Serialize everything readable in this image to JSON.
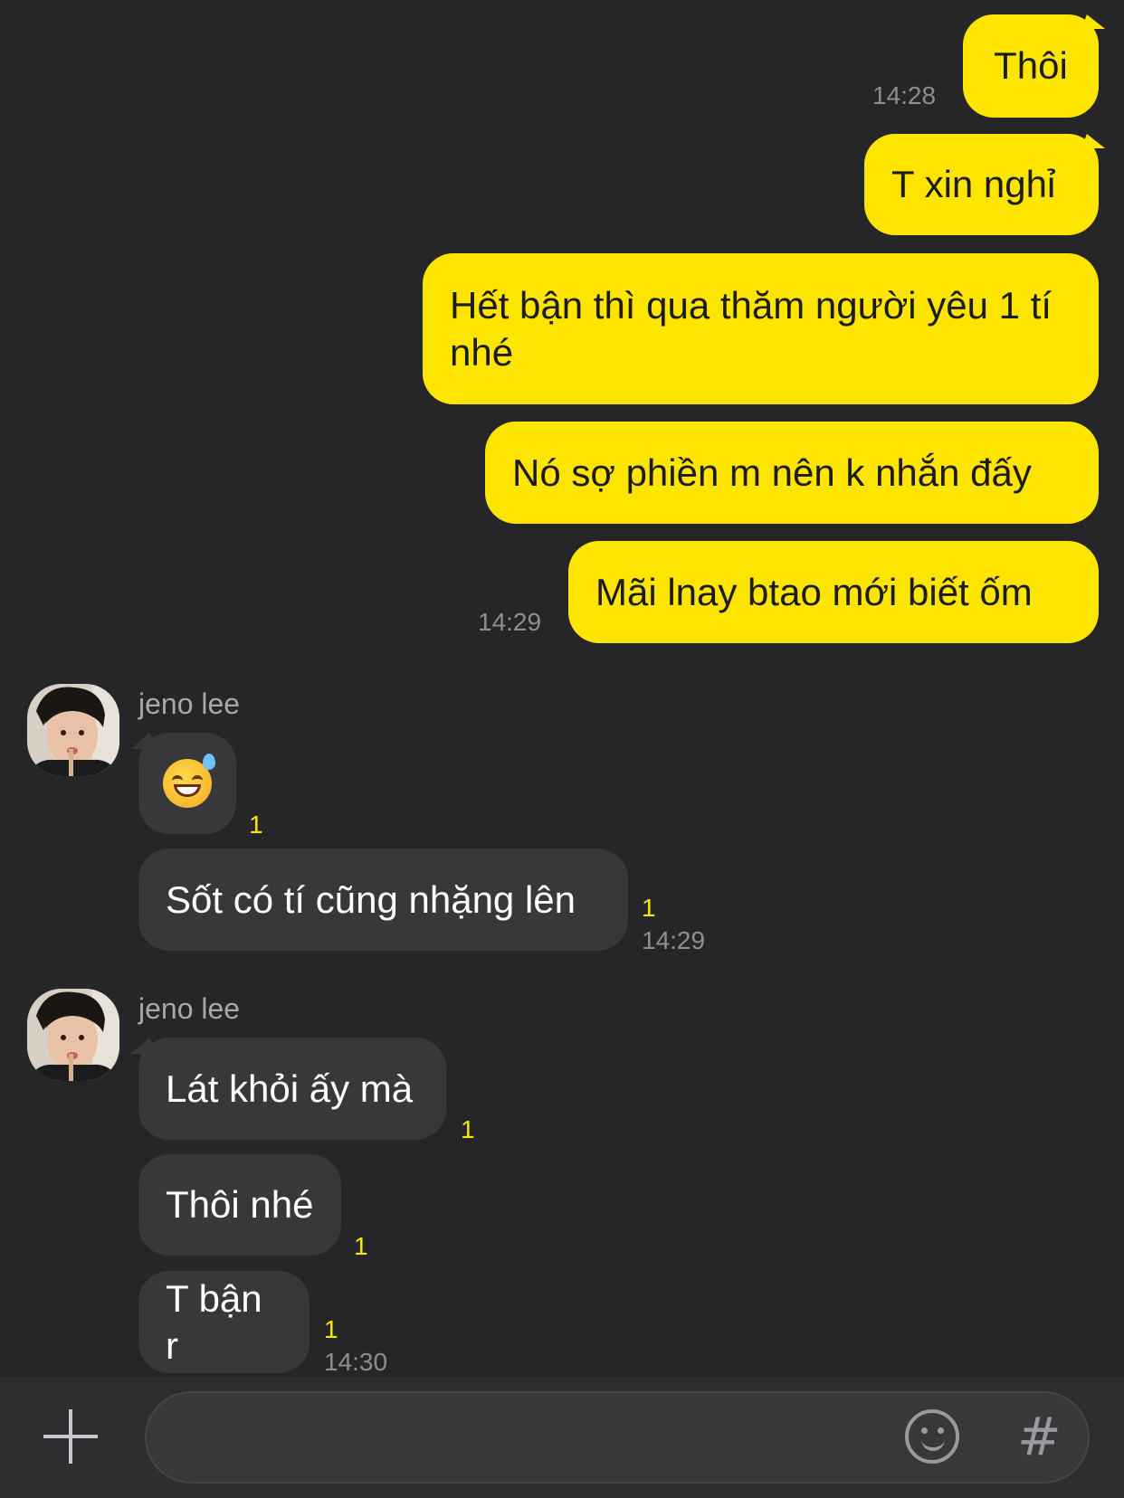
{
  "messages_out": [
    {
      "text": "Thôi",
      "time": "14:28"
    },
    {
      "text": "T xin nghỉ"
    },
    {
      "text": "Hết bận thì qua thăm người yêu 1 tí nhé"
    },
    {
      "text": "Nó sợ phiền m nên k nhắn đấy"
    },
    {
      "text": "Mãi lnay btao mới biết ốm",
      "time": "14:29"
    }
  ],
  "groups_in": [
    {
      "sender": "jeno lee",
      "messages": [
        {
          "emoji": "😅",
          "unread": "1"
        },
        {
          "text": "Sốt có tí cũng nhặng lên",
          "unread": "1",
          "time": "14:29"
        }
      ]
    },
    {
      "sender": "jeno lee",
      "messages": [
        {
          "text": "Lát khỏi ấy mà",
          "unread": "1"
        },
        {
          "text": "Thôi nhé",
          "unread": "1"
        },
        {
          "text": "T bận r",
          "unread": "1",
          "time": "14:30"
        }
      ]
    }
  ],
  "composer": {
    "placeholder": ""
  },
  "icons": {
    "attach": "plus-icon",
    "emoticon": "smile-icon",
    "tag": "hash-icon"
  },
  "colors": {
    "my_bubble": "#FEE500",
    "their_bubble": "#38383a",
    "background": "#262628",
    "unread": "#FEE500"
  }
}
